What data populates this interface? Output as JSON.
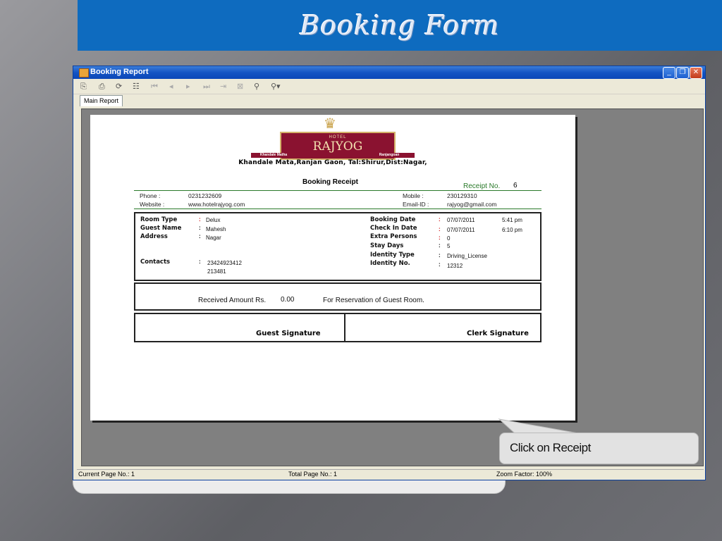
{
  "slide": {
    "title": "Booking Form"
  },
  "window": {
    "title": "Booking Report",
    "controls": {
      "minimize": "_",
      "restore": "❐",
      "close": "✕"
    }
  },
  "toolbar": {
    "icons": [
      "export-icon",
      "print-icon",
      "refresh-icon",
      "tree-icon",
      "first-page-icon",
      "prev-page-icon",
      "next-page-icon",
      "last-page-icon",
      "goto-page-icon",
      "stop-icon",
      "search-icon",
      "zoom-icon"
    ]
  },
  "tabs": [
    {
      "label": "Main Report"
    }
  ],
  "report": {
    "hotel_label": "HOTEL",
    "hotel_name": "RAJYOG",
    "ribbon_left": "Khandale Matha",
    "ribbon_right": "Ranjangoan",
    "address": "Khandale Mata,Ranjan Gaon, Tal:Shirur,Dist:Nagar,",
    "title": "Booking Receipt",
    "receipt_no_label": "Receipt No.",
    "receipt_no": "6",
    "phone_label": "Phone :",
    "phone": "0231232609",
    "website_label": "Website :",
    "website": "www.hotelrajyog.com",
    "mobile_label": "Mobile :",
    "mobile": "230129310",
    "email_label": "Email-ID :",
    "email": "rajyog@gmail.com",
    "room_type_label": "Room Type",
    "room_type": "Delux",
    "guest_name_label": "Guest Name",
    "guest_name": "Mahesh",
    "address_label": "Address",
    "address_value": "Nagar",
    "contacts_label": "Contacts",
    "contacts_1": "23424923412",
    "contacts_2": "213481",
    "booking_date_label": "Booking Date",
    "booking_date": "07/07/2011",
    "booking_time": "5:41 pm",
    "checkin_date_label": "Check In Date",
    "checkin_date": "07/07/2011",
    "checkin_time": "6:10 pm",
    "extra_persons_label": "Extra Persons",
    "extra_persons": "0",
    "stay_days_label": "Stay Days",
    "stay_days": "5",
    "identity_type_label": "Identity Type",
    "identity_type": "Driving_License",
    "identity_no_label": "Identity No.",
    "identity_no": "12312",
    "received_label": "Received Amount Rs.",
    "received_amount": "0.00",
    "reservation_text": "For Reservation of Guest Room.",
    "guest_signature": "Guest Signature",
    "clerk_signature": "Clerk Signature"
  },
  "status": {
    "current_page": "Current Page No.: 1",
    "total_page": "Total Page No.: 1",
    "zoom": "Zoom Factor: 100%"
  },
  "callout": {
    "text": "Click on Receipt"
  }
}
